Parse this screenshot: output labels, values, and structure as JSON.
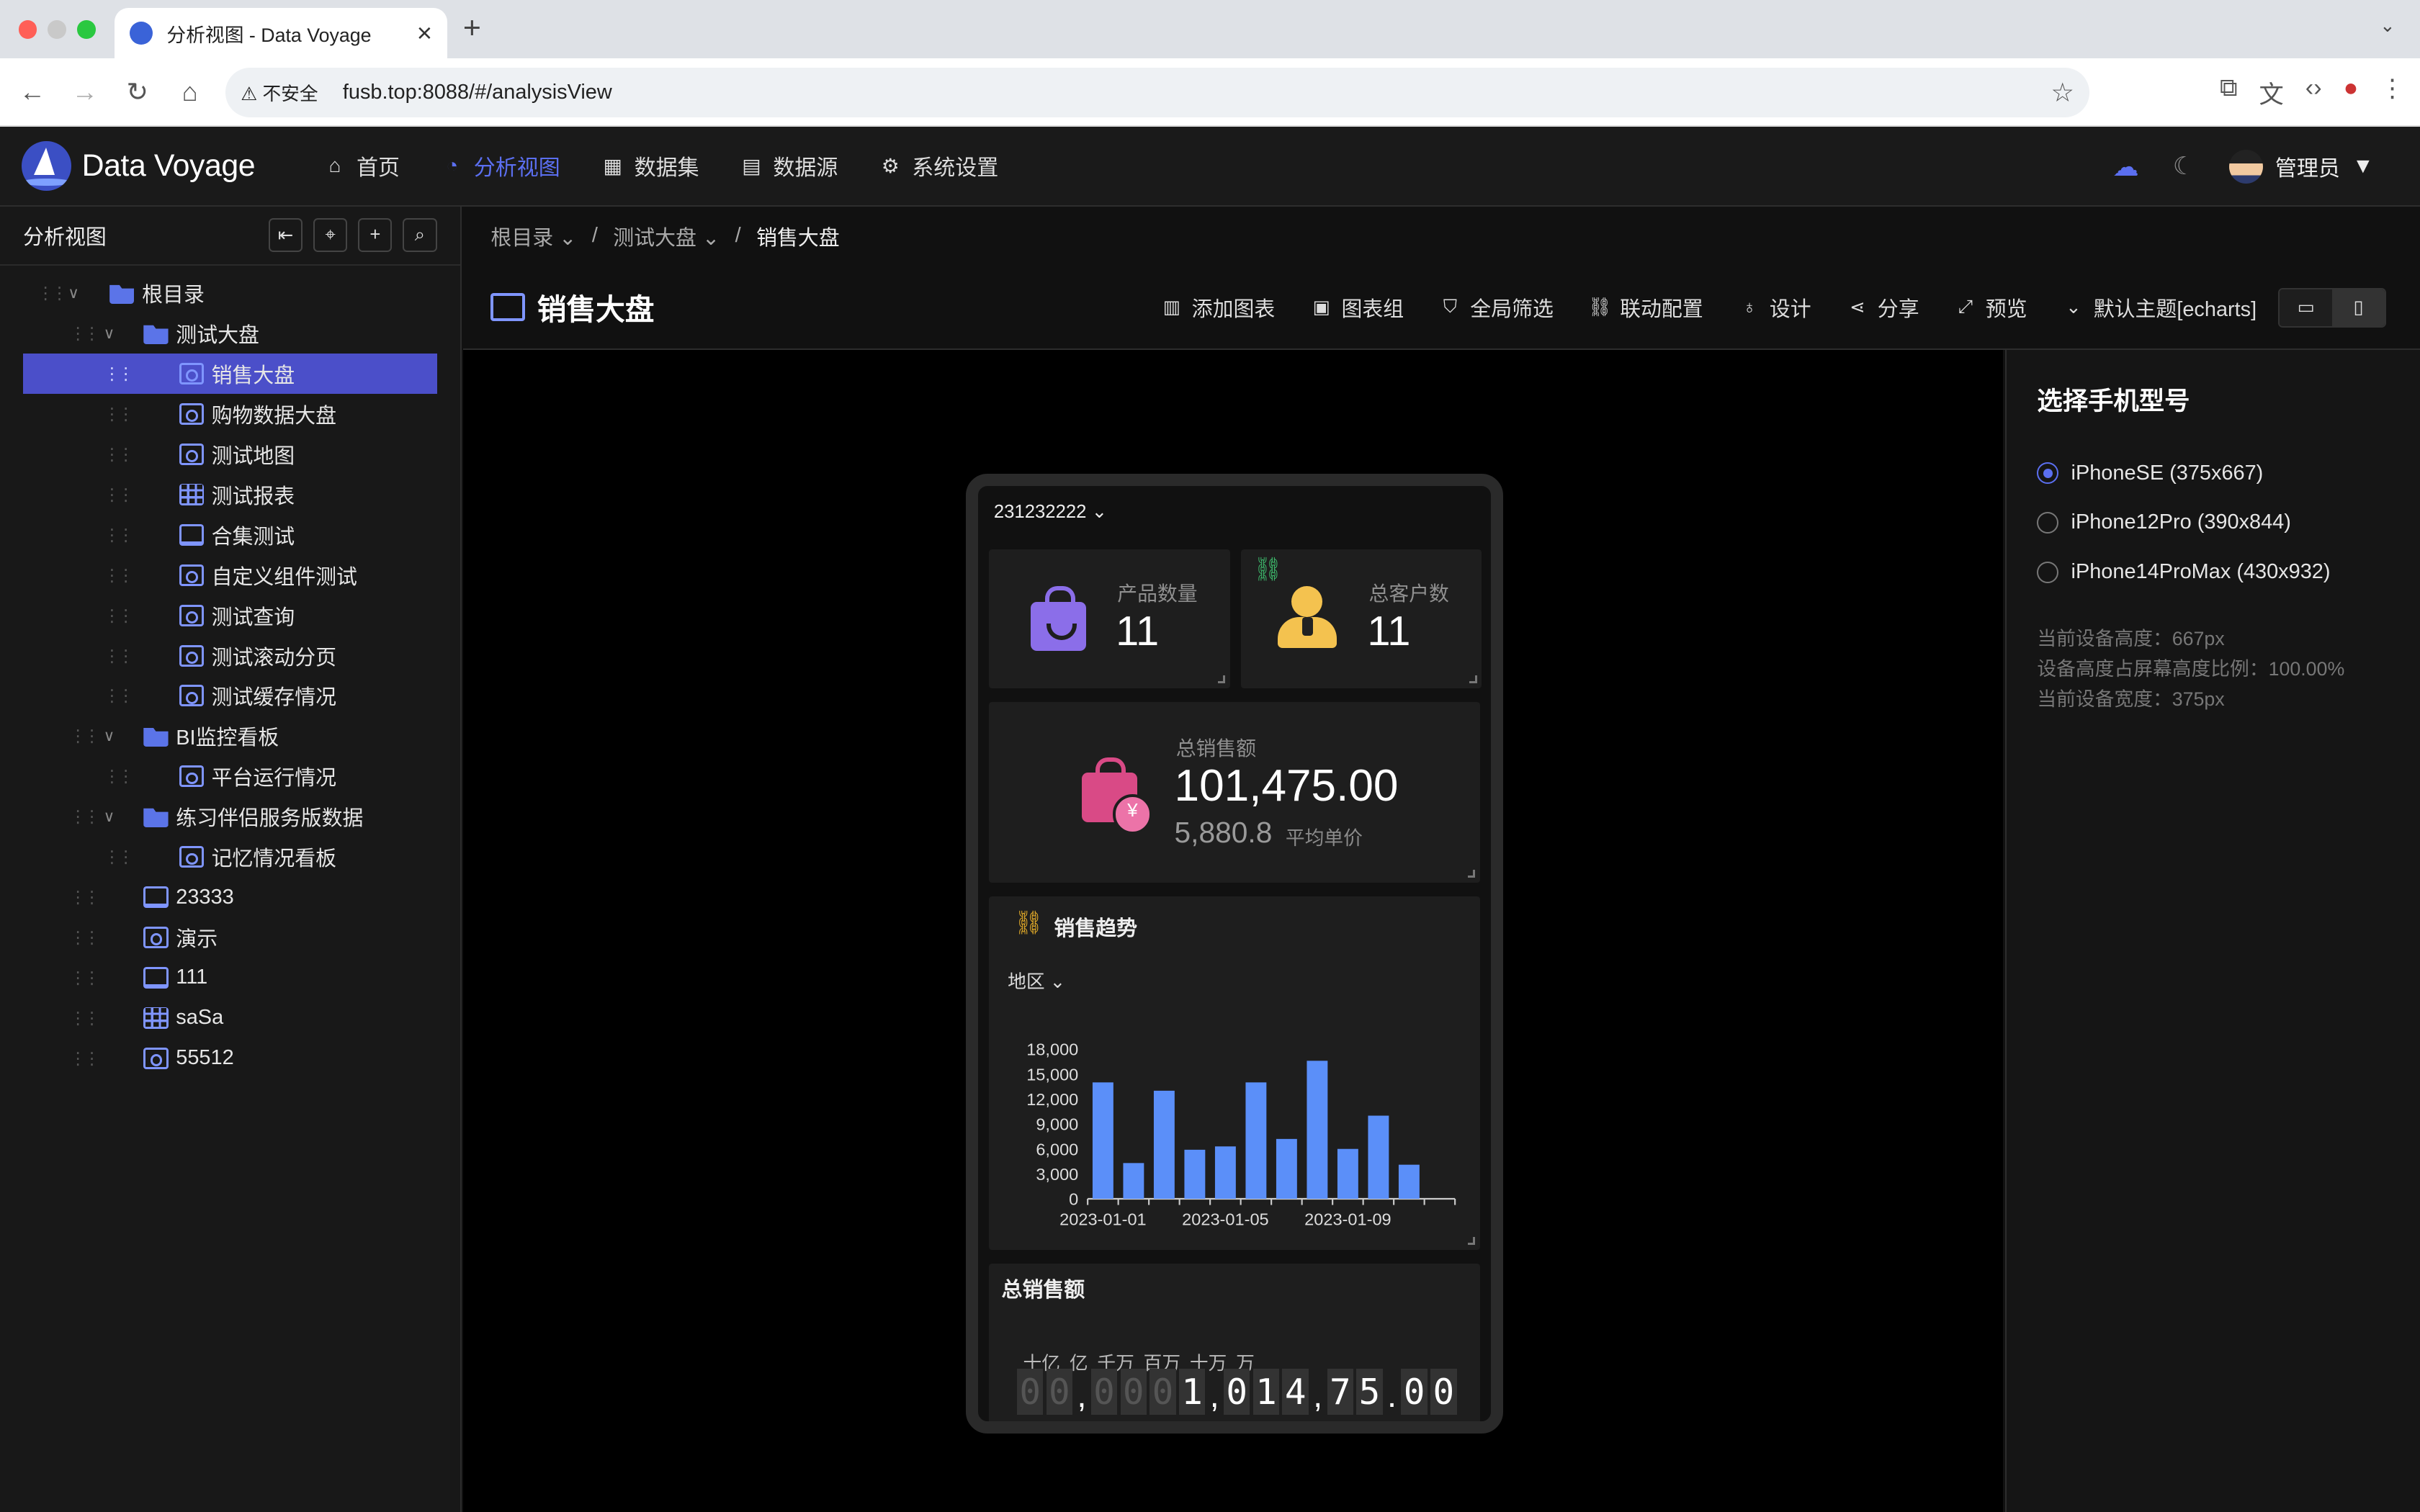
{
  "browser": {
    "tab_title": "分析视图 - Data Voyage",
    "insecure_label": "不安全",
    "url": "fusb.top:8088/#/analysisView"
  },
  "header": {
    "brand": "Data Voyage",
    "nav": [
      {
        "label": "首页",
        "icon": "home-icon"
      },
      {
        "label": "分析视图",
        "icon": "dashboard-icon",
        "active": true
      },
      {
        "label": "数据集",
        "icon": "grid-icon"
      },
      {
        "label": "数据源",
        "icon": "database-icon"
      },
      {
        "label": "系统设置",
        "icon": "gear-icon"
      }
    ],
    "user": "管理员"
  },
  "sidebar": {
    "title": "分析视图",
    "tree": [
      {
        "label": "根目录",
        "type": "folder",
        "level": 0,
        "expanded": true
      },
      {
        "label": "测试大盘",
        "type": "folder",
        "level": 1,
        "expanded": true
      },
      {
        "label": "销售大盘",
        "type": "dashboard",
        "level": 2,
        "selected": true
      },
      {
        "label": "购物数据大盘",
        "type": "dashboard",
        "level": 2
      },
      {
        "label": "测试地图",
        "type": "dashboard",
        "level": 2
      },
      {
        "label": "测试报表",
        "type": "table",
        "level": 2
      },
      {
        "label": "合集测试",
        "type": "screen",
        "level": 2
      },
      {
        "label": "自定义组件测试",
        "type": "dashboard",
        "level": 2
      },
      {
        "label": "测试查询",
        "type": "dashboard",
        "level": 2
      },
      {
        "label": "测试滚动分页",
        "type": "dashboard",
        "level": 2
      },
      {
        "label": "测试缓存情况",
        "type": "dashboard",
        "level": 2
      },
      {
        "label": "BI监控看板",
        "type": "folder",
        "level": 1,
        "expanded": true
      },
      {
        "label": "平台运行情况",
        "type": "dashboard",
        "level": 2
      },
      {
        "label": "练习伴侣服务版数据",
        "type": "folder",
        "level": 1,
        "expanded": true
      },
      {
        "label": "记忆情况看板",
        "type": "dashboard",
        "level": 2
      },
      {
        "label": "23333",
        "type": "screen",
        "level": 1
      },
      {
        "label": "演示",
        "type": "dashboard",
        "level": 1
      },
      {
        "label": "111",
        "type": "screen",
        "level": 1
      },
      {
        "label": "saSa",
        "type": "table",
        "level": 1
      },
      {
        "label": "55512",
        "type": "dashboard",
        "level": 1
      }
    ]
  },
  "breadcrumb": [
    "根目录",
    "测试大盘",
    "销售大盘"
  ],
  "page": {
    "title": "销售大盘",
    "actions": [
      {
        "label": "添加图表",
        "icon": "bar-chart-icon"
      },
      {
        "label": "图表组",
        "icon": "grid-icon"
      },
      {
        "label": "全局筛选",
        "icon": "filter-icon"
      },
      {
        "label": "联动配置",
        "icon": "link-icon"
      },
      {
        "label": "设计",
        "icon": "bulb-icon"
      },
      {
        "label": "分享",
        "icon": "share-icon"
      },
      {
        "label": "预览",
        "icon": "fullscreen-icon"
      },
      {
        "label": "默认主题[echarts]",
        "icon": "chevron-down-icon"
      }
    ]
  },
  "phone": {
    "selector": "231232222",
    "kpi1": {
      "label": "产品数量",
      "value": "11"
    },
    "kpi2": {
      "label": "总客户数",
      "value": "11"
    },
    "sales": {
      "label": "总销售额",
      "value": "101,475.00",
      "sub_value": "5,880.8",
      "sub_label": "平均单价"
    },
    "trend": {
      "title": "销售趋势",
      "filter": "地区"
    },
    "odometer": {
      "title": "总销售额",
      "units": [
        "十亿",
        "亿",
        "千万",
        "百万",
        "十万",
        "万"
      ],
      "digits": [
        "0",
        "0",
        ",",
        "0",
        "0",
        "0",
        "1",
        ",",
        "0",
        "1",
        "4",
        ",",
        "7",
        "5",
        ".",
        "0",
        "0"
      ]
    }
  },
  "chart_data": {
    "type": "bar",
    "x": [
      "2023-01-01",
      "2023-01-02",
      "2023-01-03",
      "2023-01-04",
      "2023-01-05",
      "2023-01-06",
      "2023-01-07",
      "2023-01-08",
      "2023-01-09",
      "2023-01-10",
      "2023-01-11",
      "2023-01-12"
    ],
    "x_tick_labels": [
      "2023-01-01",
      "2023-01-05",
      "2023-01-09"
    ],
    "values": [
      14000,
      4300,
      13000,
      5900,
      6300,
      14000,
      7200,
      16600,
      6000,
      10000,
      4100,
      0
    ],
    "yticks": [
      0,
      3000,
      6000,
      9000,
      12000,
      15000,
      18000
    ],
    "ytick_labels": [
      "0",
      "3,000",
      "6,000",
      "9,000",
      "12,000",
      "15,000",
      "18,000"
    ],
    "ylim": [
      0,
      18000
    ],
    "color": "#5b8ff9"
  },
  "right_panel": {
    "title": "选择手机型号",
    "options": [
      {
        "label": "iPhoneSE (375x667)",
        "selected": true
      },
      {
        "label": "iPhone12Pro (390x844)"
      },
      {
        "label": "iPhone14ProMax (430x932)"
      }
    ],
    "info": [
      "当前设备高度：667px",
      "设备高度占屏幕高度比例：100.00%",
      "当前设备宽度：375px"
    ]
  },
  "colors": {
    "accent": "#5b6ff0",
    "selected_row": "#4b4fc9",
    "bar": "#5b8ff9"
  }
}
